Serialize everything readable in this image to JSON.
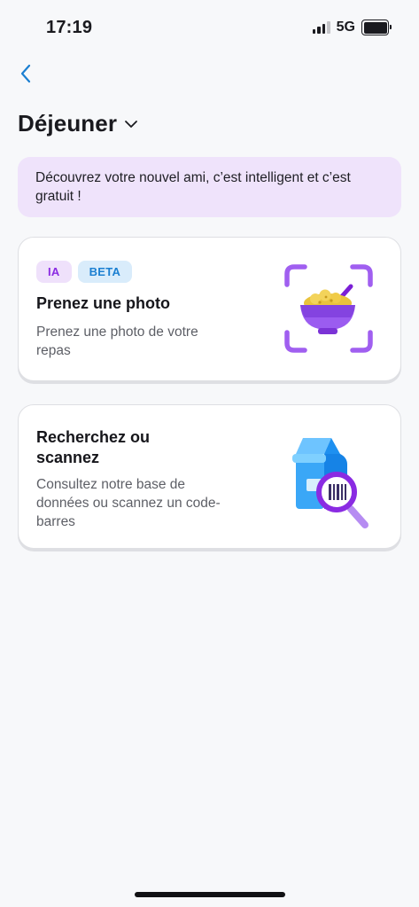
{
  "status_bar": {
    "time": "17:19",
    "network": "5G",
    "signal_icon": "cellular-signal-icon",
    "battery_icon": "battery-icon"
  },
  "header": {
    "back_icon": "chevron-left-icon",
    "title": "Déjeuner",
    "title_dropdown_icon": "chevron-down-icon"
  },
  "promo": {
    "text": "Découvrez votre nouvel ami, c’est intelligent et c’est gratuit !"
  },
  "cards": [
    {
      "badges": [
        "IA",
        "BETA"
      ],
      "title": "Prenez une photo",
      "description": "Prenez une photo de votre repas",
      "illustration_icon": "meal-photo-scan-icon"
    },
    {
      "title": "Recherchez ou scannez",
      "description": "Consultez notre base de données ou scannez un code-barres",
      "illustration_icon": "barcode-search-icon"
    }
  ],
  "colors": {
    "accent_blue": "#1b7fd1",
    "accent_purple": "#8a2be2",
    "promo_background": "#efe3fb",
    "page_background": "#f7f8fa"
  }
}
